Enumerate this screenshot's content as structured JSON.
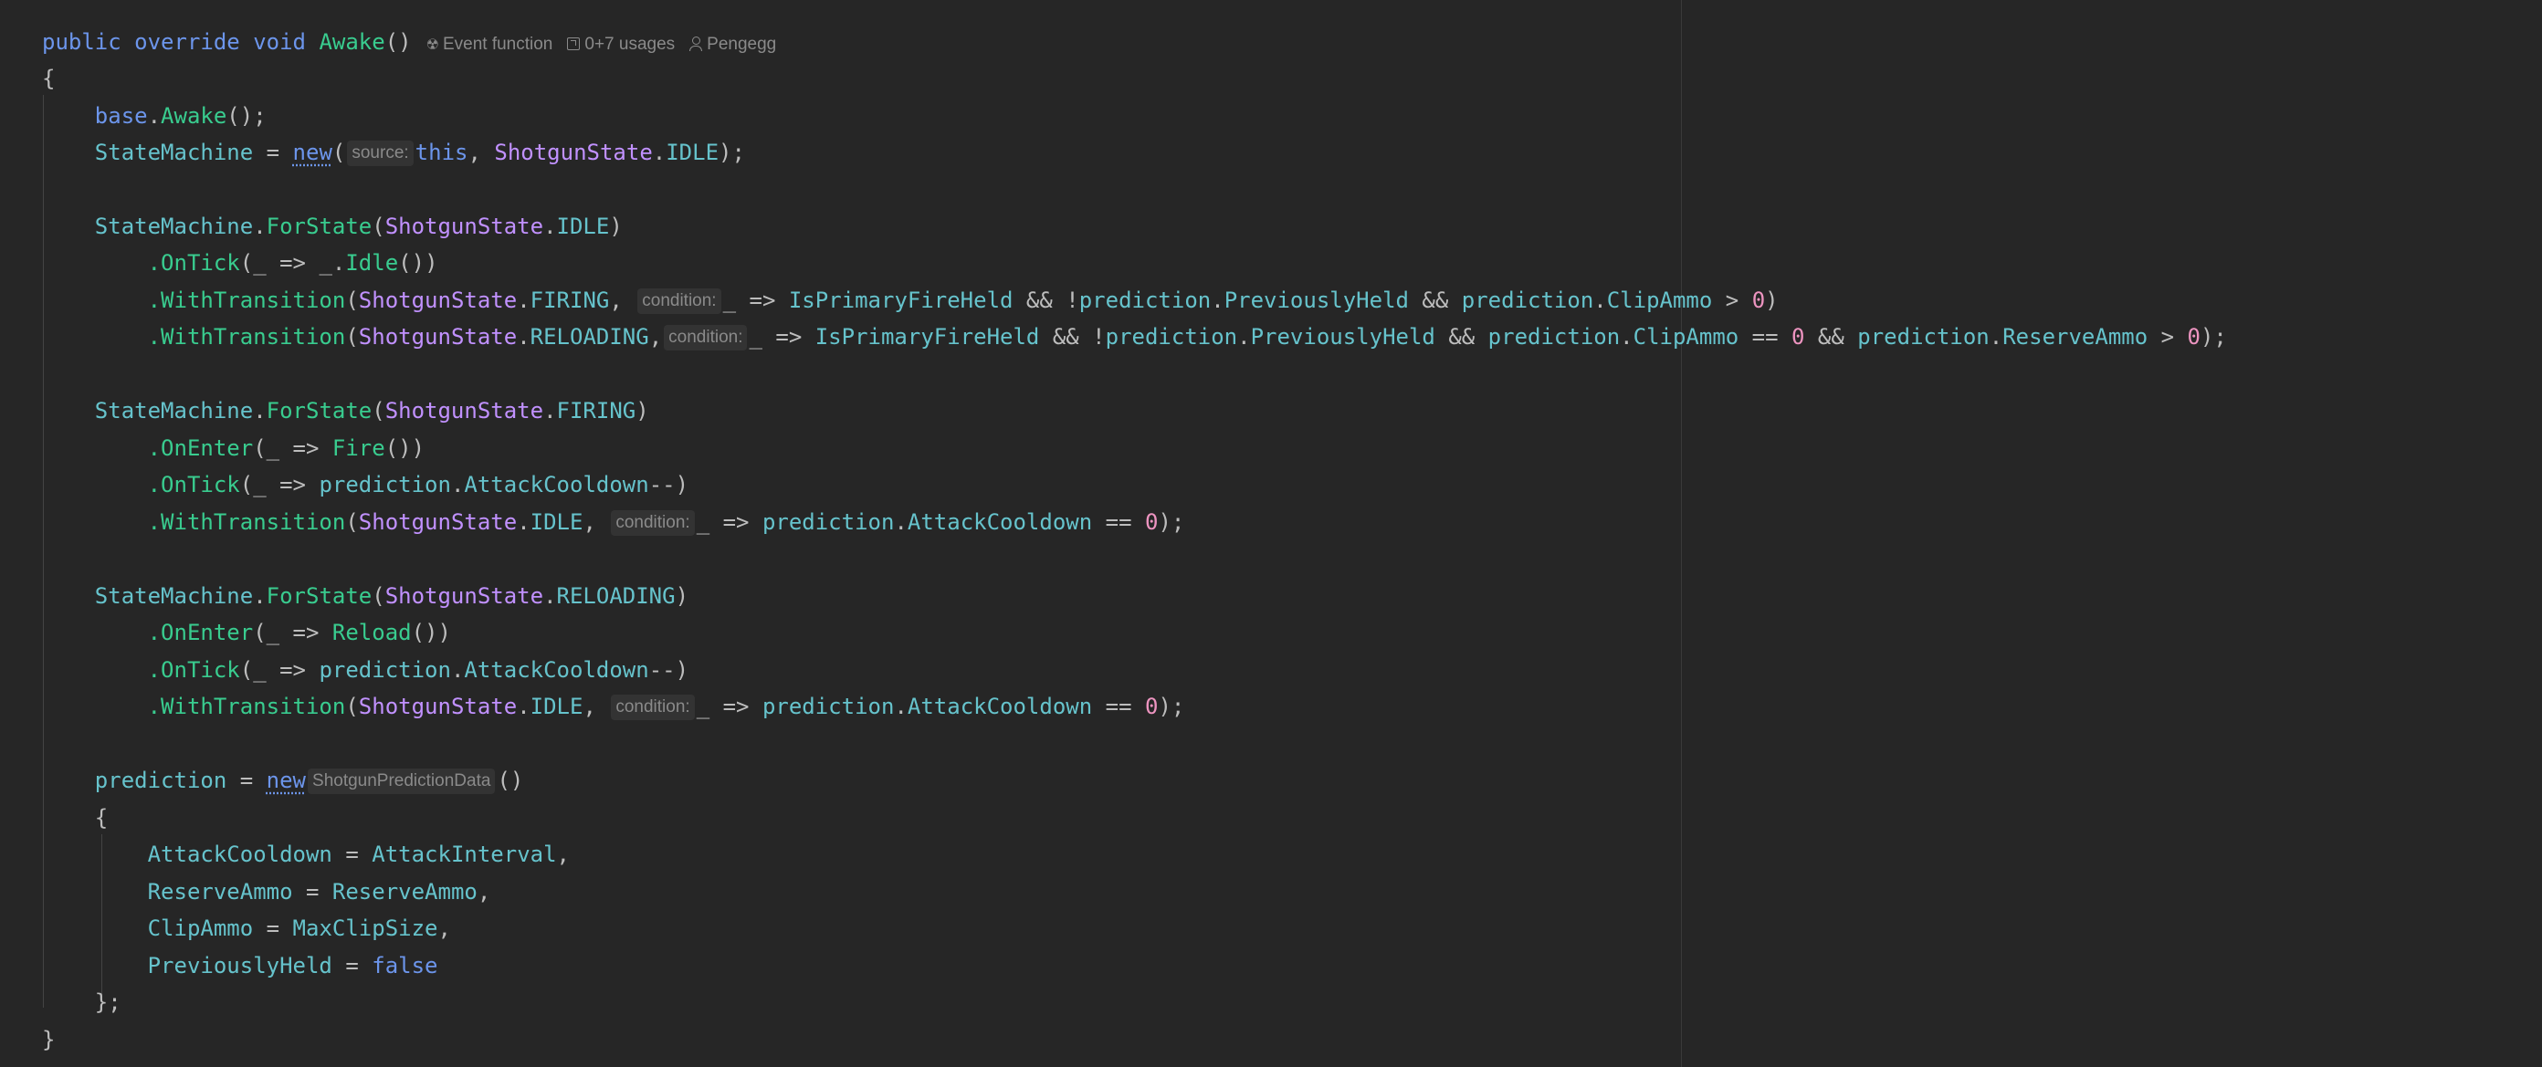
{
  "code_lens": {
    "event_function": "Event function",
    "usages": "0+7 usages",
    "author": "Pengegg"
  },
  "hints": {
    "source": "source:",
    "condition": "condition:",
    "prediction_type": "ShotgunPredictionData"
  },
  "tokens": {
    "public": "public",
    "override": "override",
    "void": "void",
    "awake_call": "Awake",
    "parens": "()",
    "open_brace": "{",
    "close_brace": "}",
    "close_brace_semi": "};",
    "base": "base",
    "dot": ".",
    "call_end": "();",
    "state_machine": "StateMachine",
    "assign": " = ",
    "new": "new",
    "open_paren": "(",
    "this": "this",
    "comma": ", ",
    "comma_tight": ",",
    "shotgun_state": "ShotgunState",
    "idle": "IDLE",
    "firing": "FIRING",
    "reloading": "RELOADING",
    "close_paren_semi": ");",
    "close_paren": ")",
    "for_state": "ForState",
    "on_tick": ".OnTick",
    "on_enter": ".OnEnter",
    "with_transition": ".WithTransition",
    "lambda_arg": "_ => ",
    "underscore_dot": "_.",
    "idle_method": "Idle",
    "fire": "Fire",
    "reload": "Reload",
    "is_primary_fire_held": "IsPrimaryFireHeld",
    "and_not": " && !",
    "and": " && ",
    "prediction": "prediction",
    "previously_held": "PreviouslyHeld",
    "clip_ammo": "ClipAmmo",
    "reserve_ammo": "ReserveAmmo",
    "attack_cooldown": "AttackCooldown",
    "attack_interval": "AttackInterval",
    "max_clip_size": "MaxClipSize",
    "gt": " > ",
    "eq": " == ",
    "zero": "0",
    "decrement": "--",
    "false": "false",
    "comma_end": ","
  }
}
